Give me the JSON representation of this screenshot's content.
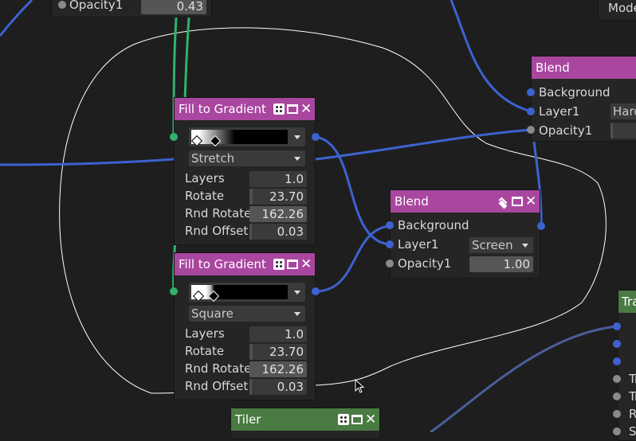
{
  "top_node": {
    "label": "Opacity1",
    "value": "0.43"
  },
  "top_right_node": {
    "label": "Mode"
  },
  "fill1": {
    "title": "Fill to Gradient",
    "mode": "Stretch",
    "layers_label": "Layers",
    "layers": "1.0",
    "rotate_label": "Rotate",
    "rotate": "23.70",
    "rnd_rotate_label": "Rnd Rotate",
    "rnd_rotate": "162.26",
    "rnd_offset_label": "Rnd Offset",
    "rnd_offset": "0.03"
  },
  "fill2": {
    "title": "Fill to Gradient",
    "mode": "Square",
    "layers_label": "Layers",
    "layers": "1.0",
    "rotate_label": "Rotate",
    "rotate": "23.70",
    "rnd_rotate_label": "Rnd Rotate",
    "rnd_rotate": "162.26",
    "rnd_offset_label": "Rnd Offset",
    "rnd_offset": "0.03"
  },
  "blend_mid": {
    "title": "Blend",
    "background_label": "Background",
    "layer1_label": "Layer1",
    "layer1_mode": "Screen",
    "opacity_label": "Opacity1",
    "opacity": "1.00"
  },
  "blend_right": {
    "title": "Blend",
    "background_label": "Background",
    "layer1_label": "Layer1",
    "layer1_mode": "Hard",
    "opacity_label": "Opacity1"
  },
  "tiler": {
    "title": "Tiler"
  },
  "right_green_node": {
    "title": "Tra",
    "port_labels": [
      "Tr",
      "Tr",
      "R",
      "S"
    ]
  },
  "colors": {
    "canvas": "#1e1e1e",
    "node_purple": "#a9469f",
    "node_green": "#4a7b42",
    "wire_blue": "#3d62d0",
    "wire_green": "#2fb36a",
    "selection_lasso": "#ffffff"
  },
  "icons": [
    "dice-icon",
    "window-icon",
    "close-icon",
    "layers-icon",
    "cursor-icon"
  ]
}
